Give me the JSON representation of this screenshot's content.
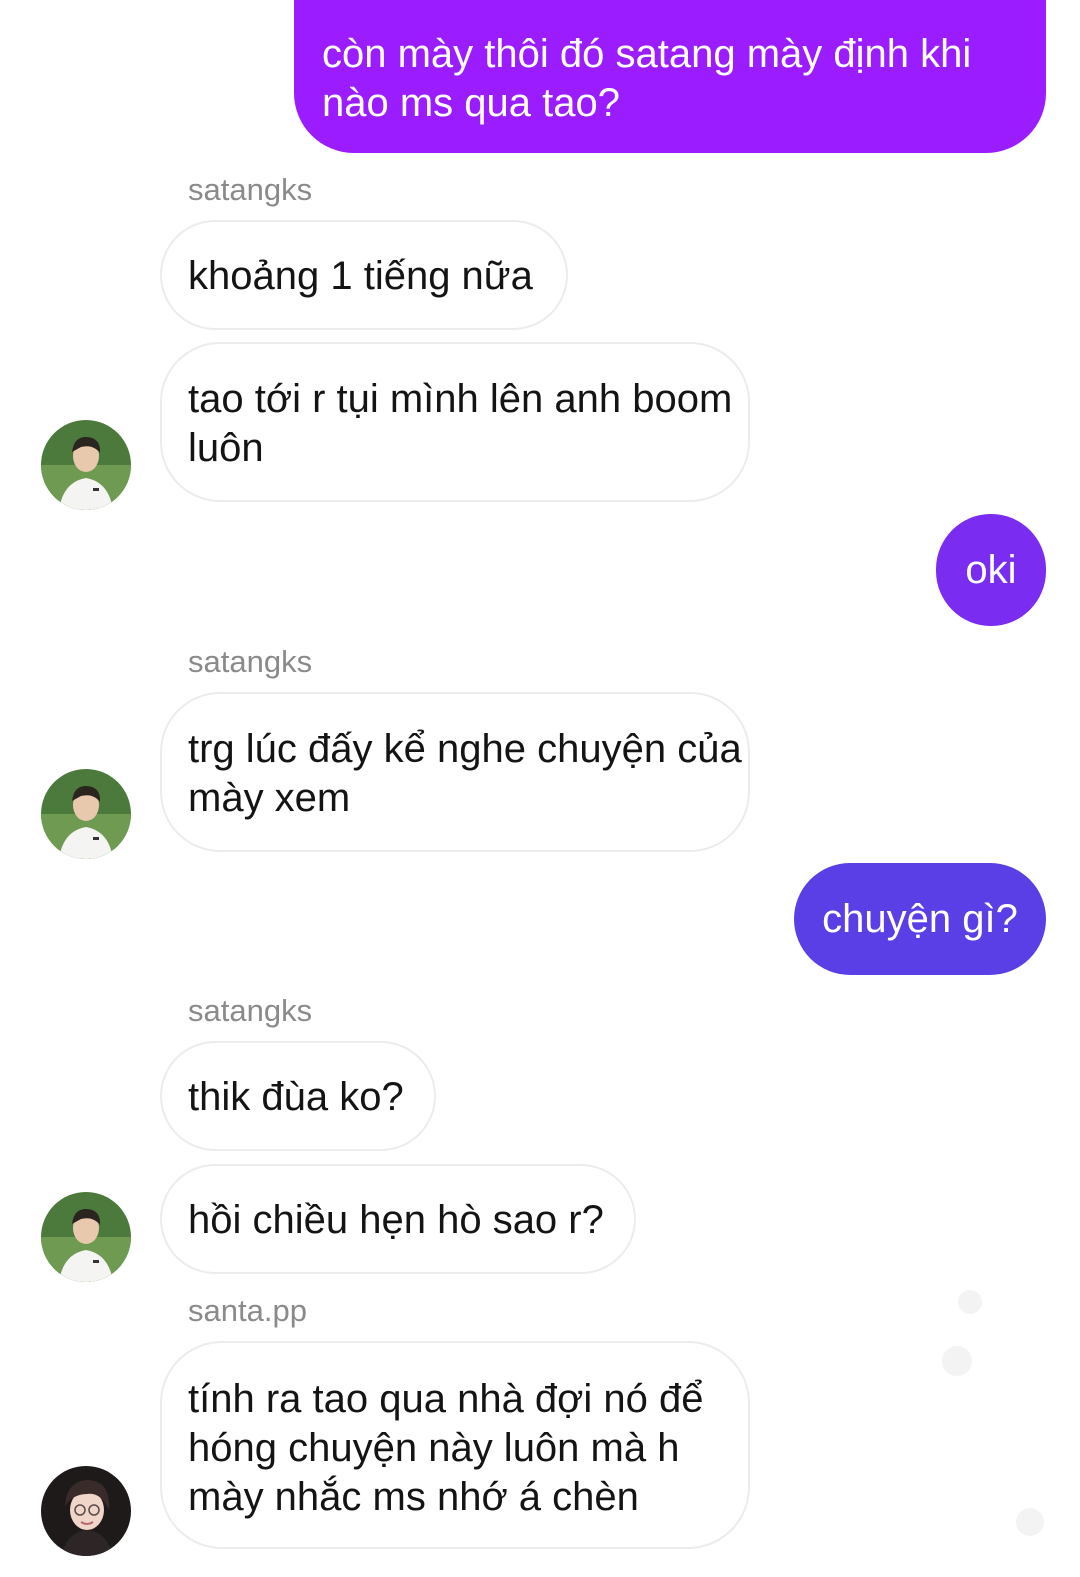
{
  "messages": [
    {
      "type": "sent",
      "text": "còn mày thôi đó satang mày định khi nào ms qua tao?"
    },
    {
      "type": "sender",
      "name": "satangks"
    },
    {
      "type": "received",
      "text": "khoảng 1 tiếng nữa"
    },
    {
      "type": "received",
      "text": "tao tới r tụi mình lên anh boom luôn"
    },
    {
      "type": "sent",
      "text": "oki"
    },
    {
      "type": "sender",
      "name": "satangks"
    },
    {
      "type": "received",
      "text": "trg lúc đấy kể nghe chuyện của mày xem"
    },
    {
      "type": "sent",
      "text": "chuyện gì?"
    },
    {
      "type": "sender",
      "name": "satangks"
    },
    {
      "type": "received",
      "text": "thik đùa ko?"
    },
    {
      "type": "received",
      "text": "hồi chiều hẹn hò sao r?"
    },
    {
      "type": "sender",
      "name": "santa.pp"
    },
    {
      "type": "received",
      "text": "tính ra tao qua nhà đợi nó để hóng chuyện này luôn mà h mày nhắc ms nhớ á chèn"
    }
  ],
  "colors": {
    "sent_top": "#9b1cff",
    "sent_mid": "#7a2cf0",
    "sent_bottom": "#5a3ee6",
    "received_bg": "#ffffff",
    "received_border": "#ececec",
    "sender_label": "#8a8a8a"
  },
  "avatars": [
    {
      "user": "satangks",
      "icon": "avatar-satangks"
    },
    {
      "user": "santa.pp",
      "icon": "avatar-santa-pp"
    }
  ]
}
